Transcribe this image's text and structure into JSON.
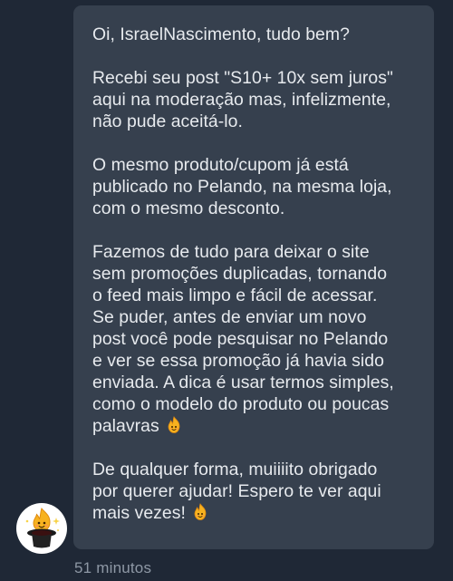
{
  "message": {
    "greeting": "Oi, IsraelNascimento, tudo bem?",
    "paragraph1": "Recebi seu post \"S10+ 10x sem juros\"\naqui na moderação mas, infelizmente,\nnão pude aceitá-lo.",
    "paragraph2": "O mesmo produto/cupom já está\npublicado no Pelando, na mesma loja,\ncom o mesmo desconto.",
    "paragraph3": "Fazemos de tudo para deixar o site\nsem promoções duplicadas, tornando\no feed mais limpo e fácil de acessar.\nSe puder, antes de enviar um novo\npost você pode pesquisar no Pelando\ne ver se essa promoção já havia sido\nenviada. A dica é usar termos simples,\ncomo o modelo do produto ou poucas\npalavras",
    "paragraph4": "De qualquer forma, muiiiito obrigado\npor querer ajudar! Espero te ver aqui\nmais vezes!",
    "emoji_icon": "pelando-flame-icon"
  },
  "timestamp": "51 minutos",
  "sender": {
    "avatar_icon": "pelando-flame-magician-icon"
  },
  "colors": {
    "background": "#1f2836",
    "bubble": "#36404e",
    "text": "#e7eaee",
    "timestamp": "#8e98a5",
    "flame": "#f7b21f"
  }
}
